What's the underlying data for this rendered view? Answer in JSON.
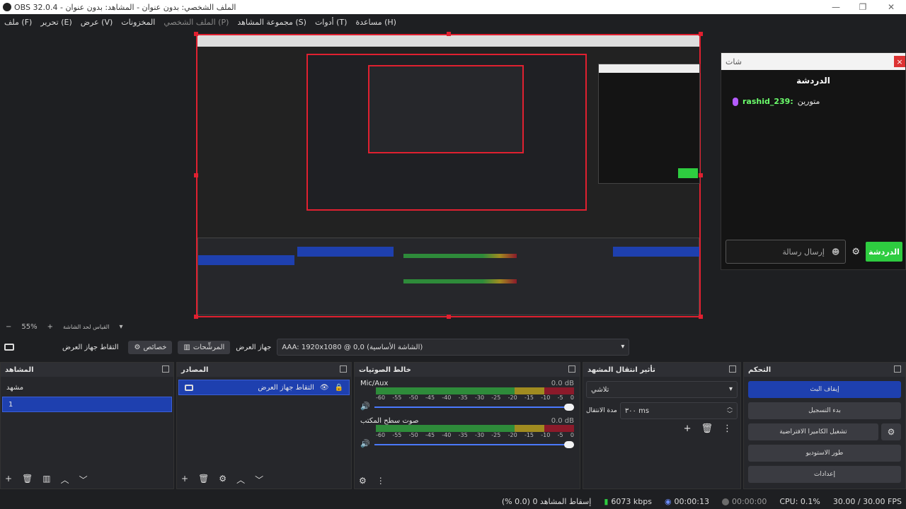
{
  "window": {
    "title": "OBS 32.0.4 - الملف الشخصي: بدون عنوان - المشاهد: بدون عنوان",
    "minimize": "—",
    "maximize": "❐",
    "close": "✕"
  },
  "menu": [
    "ملف (F)",
    "تحرير (E)",
    "عرض (V)",
    "المخزونات",
    "الملف الشخصي (P)",
    "مجموعة المشاهد (S)",
    "أدوات (T)",
    "مساعدة (H)"
  ],
  "chat": {
    "tab_title": "شات",
    "close": "×",
    "title": "الدردشة",
    "messages": [
      {
        "user": "rashid_239:",
        "text": "متورين"
      }
    ],
    "input_placeholder": "إرسال رسالة",
    "send_label": "الدردشة"
  },
  "zoom": {
    "minus": "−",
    "value": "55%",
    "plus": "+",
    "fit_label": "القياس لحد الشاشة"
  },
  "source_bar": {
    "source_label": "التقاط جهاز العرض",
    "properties": "خصائص",
    "filters": "المرشِّحات",
    "display_label": "جهاز العرض",
    "display_value": "AAA: 1920x1080 @ 0,0 (الشاشة الأساسية)"
  },
  "scenes": {
    "title": "المشاهد",
    "items": [
      "مشهد",
      "1"
    ],
    "selected_index": 1
  },
  "sources": {
    "title": "المصادر",
    "items": [
      {
        "label": "التقاط جهاز العرض"
      }
    ]
  },
  "mixer": {
    "title": "خالط الصوتيات",
    "channels": [
      {
        "name": "Mic/Aux",
        "db": "0.0 dB"
      },
      {
        "name": "صوت سطح المكتب",
        "db": "0.0 dB"
      }
    ],
    "ticks": [
      "-60",
      "-55",
      "-50",
      "-45",
      "-40",
      "-35",
      "-30",
      "-25",
      "-20",
      "-15",
      "-10",
      "-5",
      "0"
    ]
  },
  "transitions": {
    "title": "تأثير انتقال المشهد",
    "type": "تلاشي",
    "duration_label": "مدة الانتقال",
    "duration_value": "٣٠٠ ms"
  },
  "controls": {
    "title": "التحكم",
    "buttons": [
      "إيقاف البث",
      "بدء التسجيل",
      "تشغيل الكاميرا الافتراضية",
      "طور الاستوديو",
      "إعدادات"
    ]
  },
  "status": {
    "dropped": "إسقاط المشاهد 0 (0.0 %)",
    "bitrate": "6073 kbps",
    "stream_time": "00:00:13",
    "rec_time": "00:00:00",
    "cpu": "CPU: 0.1%",
    "fps": "30.00 / 30.00 FPS"
  },
  "colors": {
    "accent": "#1e40af",
    "selection": "#e02030",
    "chat_send": "#2ecc40",
    "username": "#6cff6c"
  }
}
